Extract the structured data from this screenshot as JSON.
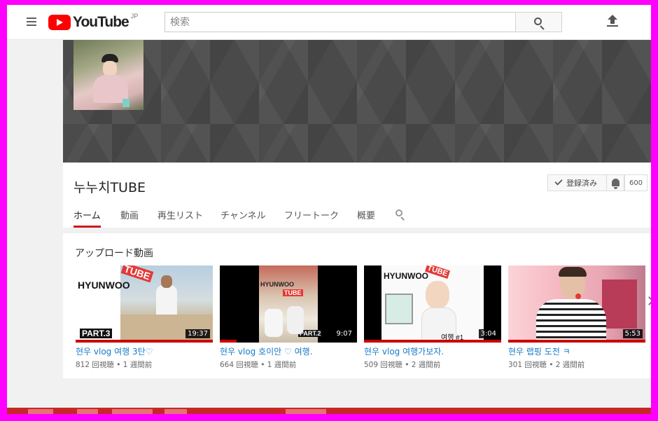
{
  "header": {
    "logo_text": "YouTube",
    "logo_region": "JP",
    "search_placeholder": "検索"
  },
  "channel": {
    "name": "누누치TUBE",
    "subscribe_label": "登録済み",
    "subscriber_count": "600",
    "tabs": [
      {
        "label": "ホーム",
        "active": true
      },
      {
        "label": "動画"
      },
      {
        "label": "再生リスト"
      },
      {
        "label": "チャンネル"
      },
      {
        "label": "フリートーク"
      },
      {
        "label": "概要"
      }
    ]
  },
  "uploads": {
    "title": "アップロード動画",
    "videos": [
      {
        "title": "현우 vlog 여행 3탄♡",
        "meta": "812 回視聴 • 1 週間前",
        "duration": "19:37",
        "thumb_text": [
          "HYUNWOO",
          "TUBE",
          "PART.3"
        ]
      },
      {
        "title": "현우 vlog 호이안 ♡ 여행.",
        "meta": "664 回視聴 • 1 週間前",
        "duration": "9:07",
        "thumb_text": [
          "HYUNWOO",
          "TUBE",
          "PART.2"
        ]
      },
      {
        "title": "현우 vlog 여행가보자.",
        "meta": "509 回視聴 • 2 週間前",
        "duration": "3:04",
        "thumb_text": [
          "HYUNWOO",
          "TUBE",
          "여행 #1"
        ]
      },
      {
        "title": "현우 랩핑 도전 ㅋ",
        "meta": "301 回視聴 • 2 週間前",
        "duration": "5:53"
      }
    ]
  },
  "colors": {
    "accent_red": "#cc181e",
    "link_blue": "#167ac6",
    "frame_magenta": "#ff00ff"
  },
  "icons": [
    "menu-icon",
    "youtube-logo",
    "search-icon",
    "upload-icon",
    "check-icon",
    "bell-icon",
    "chevron-right-icon"
  ]
}
